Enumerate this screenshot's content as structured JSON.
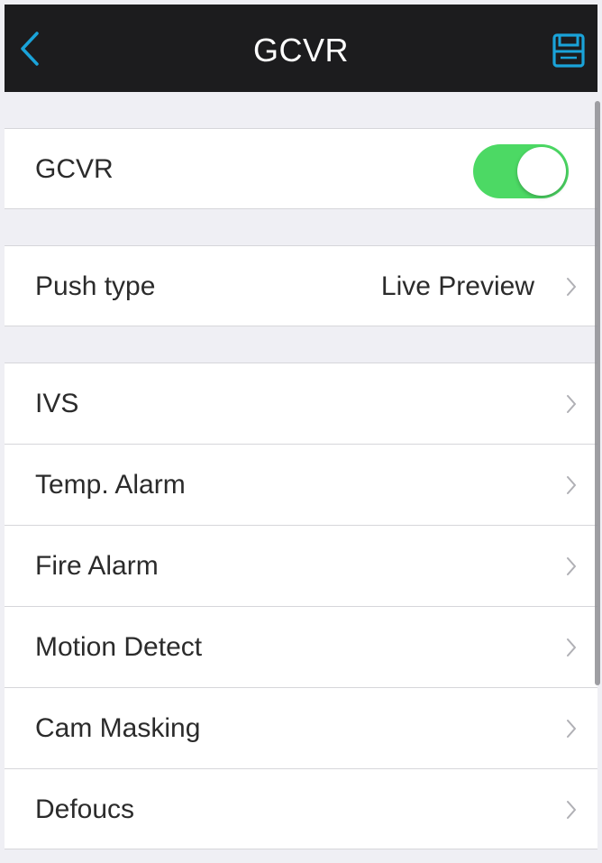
{
  "header": {
    "title": "GCVR",
    "back_icon": "chevron-left-icon",
    "save_icon": "save-icon",
    "accent_color": "#1aa3d9",
    "background_color": "#1c1c1e"
  },
  "gcvr_toggle": {
    "label": "GCVR",
    "enabled": true,
    "on_color": "#4cd964"
  },
  "push_type": {
    "label": "Push type",
    "value": "Live Preview"
  },
  "alarm_items": [
    {
      "label": "IVS"
    },
    {
      "label": "Temp. Alarm"
    },
    {
      "label": "Fire Alarm"
    },
    {
      "label": "Motion Detect"
    },
    {
      "label": "Cam Masking"
    },
    {
      "label": "Defoucs"
    }
  ]
}
